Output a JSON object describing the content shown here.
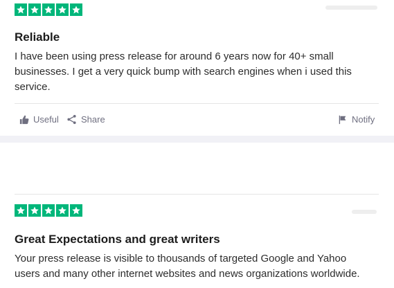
{
  "colors": {
    "star_green": "#00b67a",
    "page_gap": "#f1f1f6",
    "text": "#1c1c1c",
    "muted": "#6f6f80"
  },
  "reviews": [
    {
      "rating": 5,
      "title": "Reliable",
      "body": "I have been using press release for around 6 years now for 40+ small businesses. I get a very quick bump with search engines when i used this service.",
      "actions": {
        "useful": "Useful",
        "share": "Share",
        "notify": "Notify"
      }
    },
    {
      "rating": 5,
      "title": "Great Expectations and great writers",
      "body": "Your press release is visible to thousands of targeted Google and Yahoo users and many other internet websites and news organizations worldwide."
    }
  ],
  "icons": [
    "star-icon",
    "thumbs-up-icon",
    "share-icon",
    "flag-icon"
  ]
}
